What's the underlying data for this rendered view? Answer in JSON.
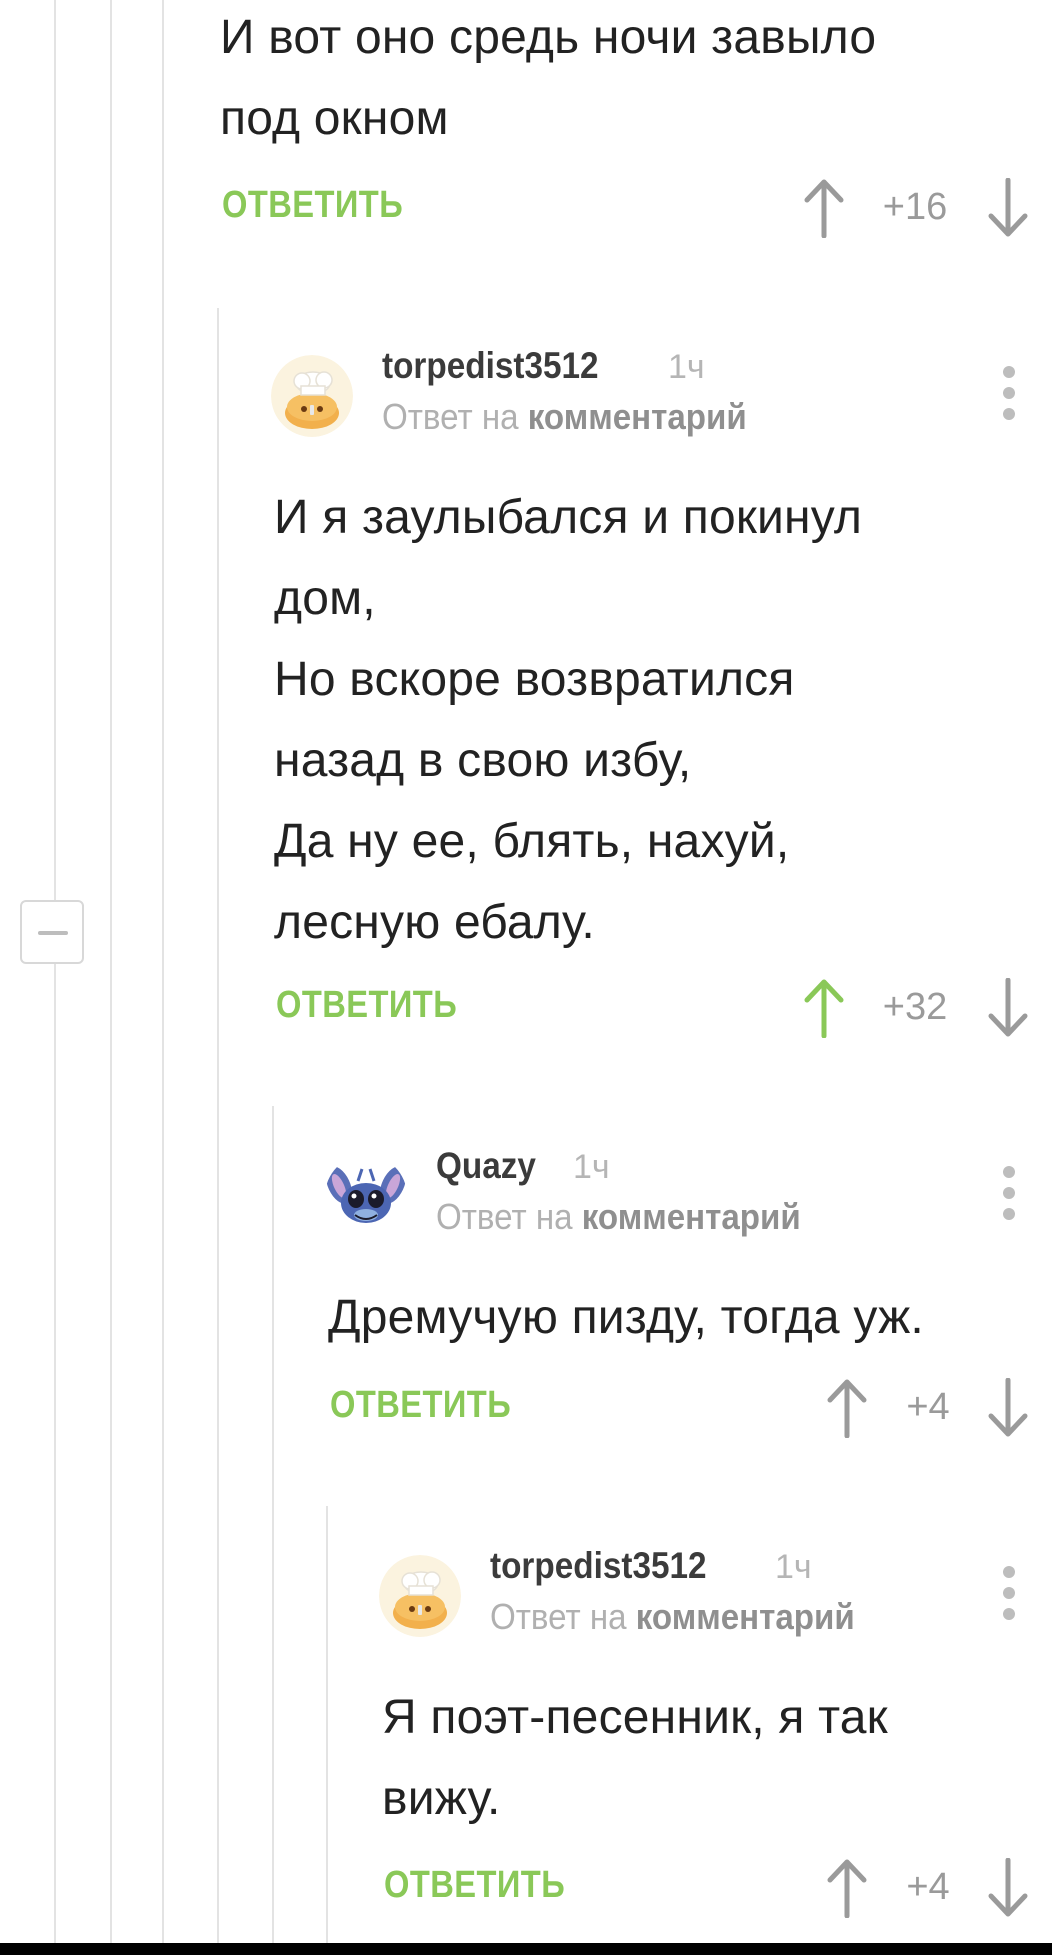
{
  "colors": {
    "accent_green": "#8ac858",
    "arrow_gray": "#9a9a9a",
    "text_dark": "#222222"
  },
  "comment1": {
    "lines": [
      "И вот оно средь ночи завыло",
      "под окном"
    ],
    "reply_label": "ОТВЕТИТЬ",
    "votes": "+16",
    "upvoted": false
  },
  "comment2": {
    "username": "torpedist3512",
    "time": "1ч",
    "reply_to_prefix": "Ответ на",
    "reply_to_link": "комментарий",
    "avatar_icon": "chef-hat-bun-avatar",
    "lines": [
      "И я заулыбался и покинул",
      "дом,",
      "Но вскоре возвратился",
      "назад в свою избу,",
      "Да ну ее, блять, нахуй,",
      "лесную ебалу."
    ],
    "reply_label": "ОТВЕТИТЬ",
    "votes": "+32",
    "upvoted": true
  },
  "comment3": {
    "username": "Quazy",
    "time": "1ч",
    "reply_to_prefix": "Ответ на",
    "reply_to_link": "комментарий",
    "avatar_icon": "stitch-avatar",
    "lines": [
      "Дремучую пизду, тогда уж."
    ],
    "reply_label": "ОТВЕТИТЬ",
    "votes": "+4",
    "upvoted": false
  },
  "comment4": {
    "username": "torpedist3512",
    "time": "1ч",
    "reply_to_prefix": "Ответ на",
    "reply_to_link": "комментарий",
    "avatar_icon": "chef-hat-bun-avatar",
    "lines": [
      "Я поэт-песенник, я так",
      "вижу."
    ],
    "reply_label": "ОТВЕТИТЬ",
    "votes": "+4",
    "upvoted": false
  }
}
